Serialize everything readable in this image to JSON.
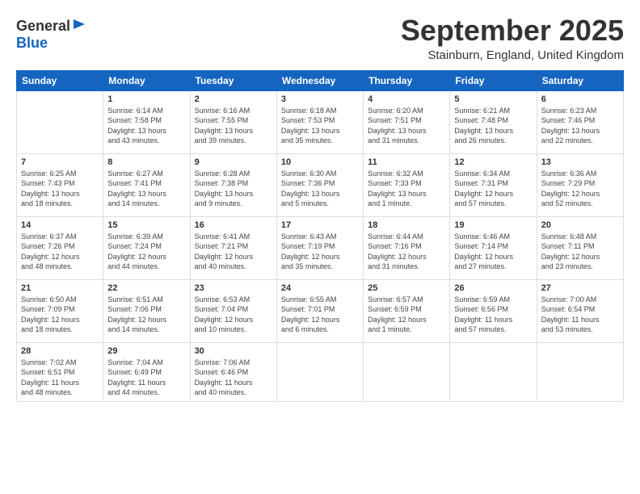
{
  "header": {
    "logo_general": "General",
    "logo_blue": "Blue",
    "month_title": "September 2025",
    "location": "Stainburn, England, United Kingdom"
  },
  "weekdays": [
    "Sunday",
    "Monday",
    "Tuesday",
    "Wednesday",
    "Thursday",
    "Friday",
    "Saturday"
  ],
  "weeks": [
    [
      {
        "day": "",
        "info": ""
      },
      {
        "day": "1",
        "info": "Sunrise: 6:14 AM\nSunset: 7:58 PM\nDaylight: 13 hours\nand 43 minutes."
      },
      {
        "day": "2",
        "info": "Sunrise: 6:16 AM\nSunset: 7:55 PM\nDaylight: 13 hours\nand 39 minutes."
      },
      {
        "day": "3",
        "info": "Sunrise: 6:18 AM\nSunset: 7:53 PM\nDaylight: 13 hours\nand 35 minutes."
      },
      {
        "day": "4",
        "info": "Sunrise: 6:20 AM\nSunset: 7:51 PM\nDaylight: 13 hours\nand 31 minutes."
      },
      {
        "day": "5",
        "info": "Sunrise: 6:21 AM\nSunset: 7:48 PM\nDaylight: 13 hours\nand 26 minutes."
      },
      {
        "day": "6",
        "info": "Sunrise: 6:23 AM\nSunset: 7:46 PM\nDaylight: 13 hours\nand 22 minutes."
      }
    ],
    [
      {
        "day": "7",
        "info": "Sunrise: 6:25 AM\nSunset: 7:43 PM\nDaylight: 13 hours\nand 18 minutes."
      },
      {
        "day": "8",
        "info": "Sunrise: 6:27 AM\nSunset: 7:41 PM\nDaylight: 13 hours\nand 14 minutes."
      },
      {
        "day": "9",
        "info": "Sunrise: 6:28 AM\nSunset: 7:38 PM\nDaylight: 13 hours\nand 9 minutes."
      },
      {
        "day": "10",
        "info": "Sunrise: 6:30 AM\nSunset: 7:36 PM\nDaylight: 13 hours\nand 5 minutes."
      },
      {
        "day": "11",
        "info": "Sunrise: 6:32 AM\nSunset: 7:33 PM\nDaylight: 13 hours\nand 1 minute."
      },
      {
        "day": "12",
        "info": "Sunrise: 6:34 AM\nSunset: 7:31 PM\nDaylight: 12 hours\nand 57 minutes."
      },
      {
        "day": "13",
        "info": "Sunrise: 6:36 AM\nSunset: 7:29 PM\nDaylight: 12 hours\nand 52 minutes."
      }
    ],
    [
      {
        "day": "14",
        "info": "Sunrise: 6:37 AM\nSunset: 7:26 PM\nDaylight: 12 hours\nand 48 minutes."
      },
      {
        "day": "15",
        "info": "Sunrise: 6:39 AM\nSunset: 7:24 PM\nDaylight: 12 hours\nand 44 minutes."
      },
      {
        "day": "16",
        "info": "Sunrise: 6:41 AM\nSunset: 7:21 PM\nDaylight: 12 hours\nand 40 minutes."
      },
      {
        "day": "17",
        "info": "Sunrise: 6:43 AM\nSunset: 7:19 PM\nDaylight: 12 hours\nand 35 minutes."
      },
      {
        "day": "18",
        "info": "Sunrise: 6:44 AM\nSunset: 7:16 PM\nDaylight: 12 hours\nand 31 minutes."
      },
      {
        "day": "19",
        "info": "Sunrise: 6:46 AM\nSunset: 7:14 PM\nDaylight: 12 hours\nand 27 minutes."
      },
      {
        "day": "20",
        "info": "Sunrise: 6:48 AM\nSunset: 7:11 PM\nDaylight: 12 hours\nand 23 minutes."
      }
    ],
    [
      {
        "day": "21",
        "info": "Sunrise: 6:50 AM\nSunset: 7:09 PM\nDaylight: 12 hours\nand 18 minutes."
      },
      {
        "day": "22",
        "info": "Sunrise: 6:51 AM\nSunset: 7:06 PM\nDaylight: 12 hours\nand 14 minutes."
      },
      {
        "day": "23",
        "info": "Sunrise: 6:53 AM\nSunset: 7:04 PM\nDaylight: 12 hours\nand 10 minutes."
      },
      {
        "day": "24",
        "info": "Sunrise: 6:55 AM\nSunset: 7:01 PM\nDaylight: 12 hours\nand 6 minutes."
      },
      {
        "day": "25",
        "info": "Sunrise: 6:57 AM\nSunset: 6:59 PM\nDaylight: 12 hours\nand 1 minute."
      },
      {
        "day": "26",
        "info": "Sunrise: 6:59 AM\nSunset: 6:56 PM\nDaylight: 11 hours\nand 57 minutes."
      },
      {
        "day": "27",
        "info": "Sunrise: 7:00 AM\nSunset: 6:54 PM\nDaylight: 11 hours\nand 53 minutes."
      }
    ],
    [
      {
        "day": "28",
        "info": "Sunrise: 7:02 AM\nSunset: 6:51 PM\nDaylight: 11 hours\nand 48 minutes."
      },
      {
        "day": "29",
        "info": "Sunrise: 7:04 AM\nSunset: 6:49 PM\nDaylight: 11 hours\nand 44 minutes."
      },
      {
        "day": "30",
        "info": "Sunrise: 7:06 AM\nSunset: 6:46 PM\nDaylight: 11 hours\nand 40 minutes."
      },
      {
        "day": "",
        "info": ""
      },
      {
        "day": "",
        "info": ""
      },
      {
        "day": "",
        "info": ""
      },
      {
        "day": "",
        "info": ""
      }
    ]
  ]
}
